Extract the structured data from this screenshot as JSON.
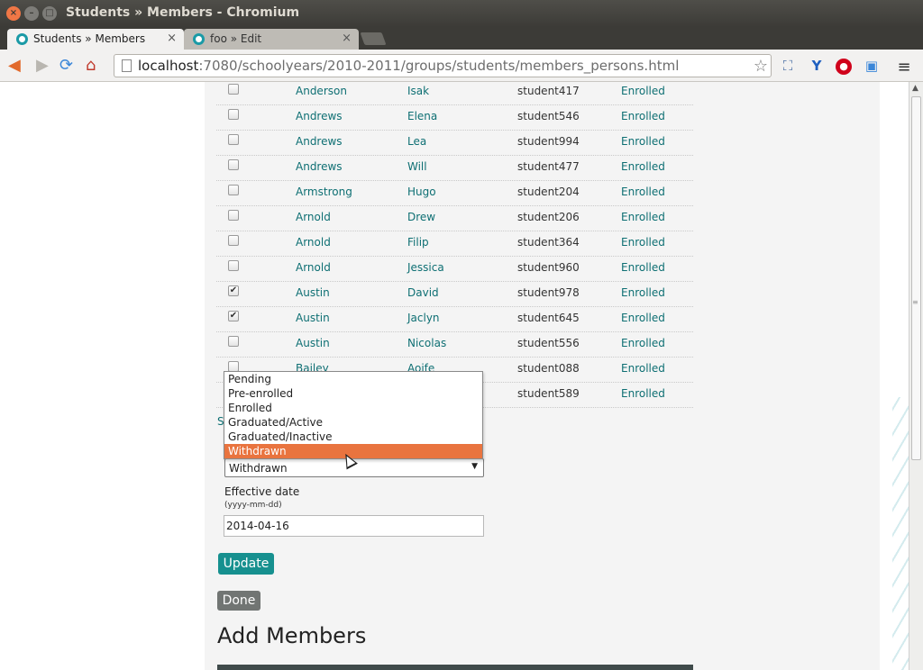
{
  "window": {
    "title": "Students » Members - Chromium",
    "buttons": {
      "close": "×",
      "minimize": "–",
      "maximize": "□"
    }
  },
  "tabs": [
    {
      "label": "Students » Members",
      "close": "×"
    },
    {
      "label": "foo » Edit",
      "close": "×"
    }
  ],
  "toolbar": {
    "url_host": "localhost",
    "url_rest": ":7080/schoolyears/2010-2011/groups/students/members_persons.html",
    "icons": {
      "back": "◀",
      "forward": "▶",
      "reload": "⟳",
      "home": "⌂",
      "star": "☆",
      "ext1": "⛶",
      "ext2": "Y",
      "ext3": "●",
      "ext4": "▣",
      "menu": "≡"
    }
  },
  "members": [
    {
      "checked": false,
      "last": "Anderson",
      "first": "Isak",
      "username": "student417",
      "status": "Enrolled"
    },
    {
      "checked": false,
      "last": "Andrews",
      "first": "Elena",
      "username": "student546",
      "status": "Enrolled"
    },
    {
      "checked": false,
      "last": "Andrews",
      "first": "Lea",
      "username": "student994",
      "status": "Enrolled"
    },
    {
      "checked": false,
      "last": "Andrews",
      "first": "Will",
      "username": "student477",
      "status": "Enrolled"
    },
    {
      "checked": false,
      "last": "Armstrong",
      "first": "Hugo",
      "username": "student204",
      "status": "Enrolled"
    },
    {
      "checked": false,
      "last": "Arnold",
      "first": "Drew",
      "username": "student206",
      "status": "Enrolled"
    },
    {
      "checked": false,
      "last": "Arnold",
      "first": "Filip",
      "username": "student364",
      "status": "Enrolled"
    },
    {
      "checked": false,
      "last": "Arnold",
      "first": "Jessica",
      "username": "student960",
      "status": "Enrolled"
    },
    {
      "checked": true,
      "last": "Austin",
      "first": "David",
      "username": "student978",
      "status": "Enrolled"
    },
    {
      "checked": true,
      "last": "Austin",
      "first": "Jaclyn",
      "username": "student645",
      "status": "Enrolled"
    },
    {
      "checked": false,
      "last": "Austin",
      "first": "Nicolas",
      "username": "student556",
      "status": "Enrolled"
    },
    {
      "checked": false,
      "last": "Bailey",
      "first": "Aoife",
      "username": "student088",
      "status": "Enrolled"
    },
    {
      "checked": false,
      "last": "",
      "first": "",
      "username": "student589",
      "status": "Enrolled"
    }
  ],
  "section_partial": "S",
  "status_select": {
    "value": "Withdrawn",
    "options": [
      "Pending",
      "Pre-enrolled",
      "Enrolled",
      "Graduated/Active",
      "Graduated/Inactive",
      "Withdrawn"
    ],
    "highlighted": "Withdrawn",
    "arrow": "▼"
  },
  "effective_date": {
    "label": "Effective date",
    "format_hint": "(yyyy-mm-dd)",
    "value": "2014-04-16"
  },
  "buttons": {
    "update": "Update",
    "done": "Done"
  },
  "add_members": {
    "heading": "Add Members"
  },
  "colors": {
    "link": "#0e6f73",
    "update_button": "#16908f",
    "done_button": "#717573",
    "dropdown_highlight": "#e9743f"
  }
}
